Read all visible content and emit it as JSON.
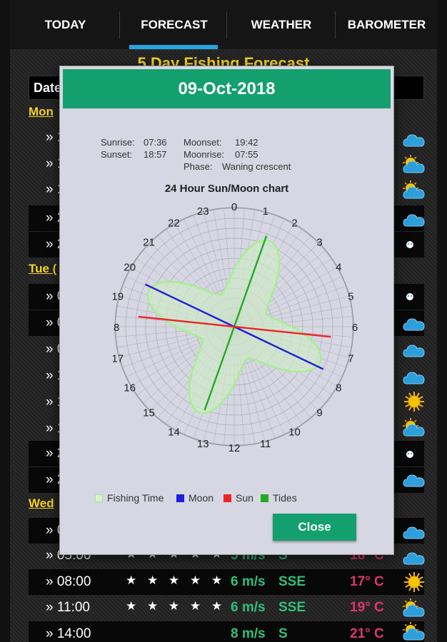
{
  "tabs": [
    {
      "label": "TODAY",
      "active": false
    },
    {
      "label": "FORECAST",
      "active": true
    },
    {
      "label": "WEATHER",
      "active": false
    },
    {
      "label": "BAROMETER",
      "active": false
    }
  ],
  "forecast": {
    "title": "5 Day Fishing Forecast",
    "header_partial": "Date",
    "days": [
      "Mon",
      "Tue (",
      "Wed"
    ],
    "row_prefix_visible": [
      "» 1",
      "» 1",
      "» 1",
      "» 2",
      "» 2",
      "» 0",
      "» 0",
      "» 0",
      "» 1",
      "» 1",
      "» 1",
      "» 2",
      "» 2",
      "» 0"
    ],
    "rows": [
      {
        "time": "» 05:00",
        "stars": "★ ★ ★ ★ ★",
        "wind": "5 m/s",
        "dir": "S",
        "temp": "18° C",
        "icon": "cloud-icon"
      },
      {
        "time": "» 08:00",
        "stars": "★ ★ ★ ★ ★",
        "wind": "6 m/s",
        "dir": "SSE",
        "temp": "17° C",
        "icon": "sun-icon"
      },
      {
        "time": "» 11:00",
        "stars": "★ ★ ★ ★ ★",
        "wind": "6 m/s",
        "dir": "SSE",
        "temp": "19° C",
        "icon": "partly-cloudy-icon"
      },
      {
        "time": "» 14:00",
        "stars": "",
        "wind": "8 m/s",
        "dir": "S",
        "temp": "21° C",
        "icon": "partly-cloudy-icon"
      }
    ],
    "side_icons": [
      "cloud-icon",
      "partly-cloudy-icon",
      "partly-cloudy-icon",
      "cloud-icon",
      "moon-cloud-icon",
      "moon-cloud-icon",
      "cloud-icon",
      "cloud-icon",
      "cloud-icon",
      "sun-icon",
      "partly-cloudy-icon",
      "moon-cloud-icon",
      "cloud-icon",
      "cloud-icon"
    ]
  },
  "dialog": {
    "date": "09-Oct-2018",
    "sunrise_label": "Sunrise:",
    "sunrise": "07:36",
    "sunset_label": "Sunset:",
    "sunset": "18:57",
    "moonset_label": "Moonset:",
    "moonset": "19:42",
    "moonrise_label": "Moonrise:",
    "moonrise": "07:55",
    "phase_label": "Phase:",
    "phase": "Waning crescent",
    "chart_title": "24 Hour Sun/Moon chart",
    "legend": [
      "Fishing Time",
      "Moon",
      "Sun",
      "Tides"
    ],
    "close_label": "Close"
  },
  "colors": {
    "accent": "#14a06e",
    "tab_indicator": "#29a3dd",
    "forecast_title": "#f5d327",
    "wind": "#2fc07a",
    "temp": "#e0346f",
    "moon": "#1e1edb",
    "sun": "#ee2222",
    "tides": "#22aa22",
    "fishing": "#d5f5c8"
  },
  "chart_data": {
    "type": "polar",
    "hours": [
      "0",
      "1",
      "2",
      "3",
      "4",
      "5",
      "6",
      "7",
      "8",
      "9",
      "10",
      "11",
      "12",
      "13",
      "14",
      "15",
      "16",
      "17",
      "18",
      "19",
      "20",
      "21",
      "22",
      "23"
    ],
    "moon_hour": 19.7,
    "sun_hour": 18.4,
    "tides_hour": 1.3,
    "fishing_time_lobes": [
      1.5,
      7.5,
      13.5,
      19.5
    ],
    "grid": true,
    "legend_position": "bottom"
  }
}
